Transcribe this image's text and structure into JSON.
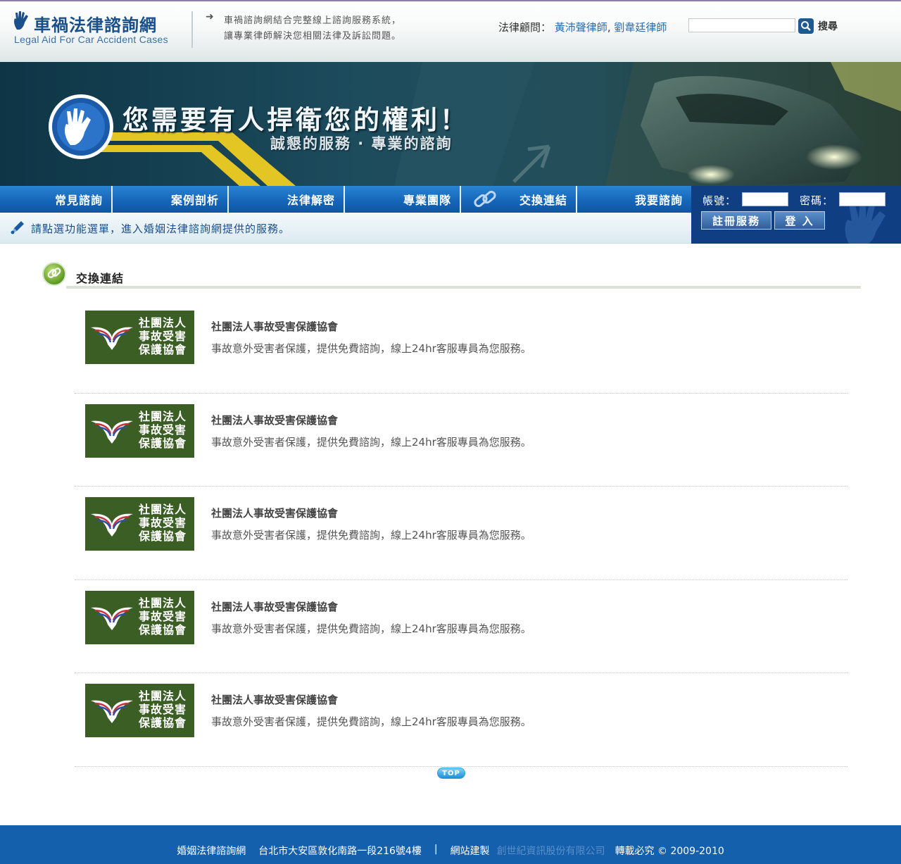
{
  "header": {
    "logo_title": "車禍法律諮詢網",
    "logo_subtitle": "Legal Aid For Car Accident Cases",
    "intro_line1": "車禍諮詢網結合完整線上諮詢服務系統，",
    "intro_line2": "讓專業律師解決您相關法律及訴訟問題。",
    "advisor_label": "法律顧問：",
    "advisor_1": "黃沛聲律師",
    "advisor_sep": ",",
    "advisor_2": "劉韋廷律師",
    "search_button": "搜尋"
  },
  "banner": {
    "headline": "您需要有人捍衛您的權利！",
    "subline": "誠懇的服務 · 專業的諮詢"
  },
  "nav": {
    "items": [
      {
        "label": "常見諮詢"
      },
      {
        "label": "案例剖析"
      },
      {
        "label": "法律解密"
      },
      {
        "label": "專業團隊"
      },
      {
        "label": "交換連結"
      },
      {
        "label": "我要諮詢"
      }
    ]
  },
  "subbar": {
    "message": "請點選功能選單，進入婚姻法律諮詢網提供的服務。"
  },
  "login": {
    "account_label": "帳號：",
    "password_label": "密碼：",
    "register_button": "註冊服務",
    "login_button": "登 入"
  },
  "section": {
    "title": "交換連結"
  },
  "links": [
    {
      "logo_line1": "社團法人",
      "logo_line2": "事故受害",
      "logo_line3": "保護協會",
      "title": "社團法人事故受害保護協會",
      "desc": "事故意外受害者保護，提供免費諮詢，線上24hr客服專員為您服務。"
    },
    {
      "logo_line1": "社團法人",
      "logo_line2": "事故受害",
      "logo_line3": "保護協會",
      "title": "社團法人事故受害保護協會",
      "desc": "事故意外受害者保護，提供免費諮詢，線上24hr客服專員為您服務。"
    },
    {
      "logo_line1": "社團法人",
      "logo_line2": "事故受害",
      "logo_line3": "保護協會",
      "title": "社團法人事故受害保護協會",
      "desc": "事故意外受害者保護，提供免費諮詢，線上24hr客服專員為您服務。"
    },
    {
      "logo_line1": "社團法人",
      "logo_line2": "事故受害",
      "logo_line3": "保護協會",
      "title": "社團法人事故受害保護協會",
      "desc": "事故意外受害者保護，提供免費諮詢，線上24hr客服專員為您服務。"
    },
    {
      "logo_line1": "社團法人",
      "logo_line2": "事故受害",
      "logo_line3": "保護協會",
      "title": "社團法人事故受害保護協會",
      "desc": "事故意外受害者保護，提供免費諮詢，線上24hr客服專員為您服務。"
    }
  ],
  "top_button": "TOP",
  "footer": {
    "site_name": "婚姻法律諮詢網",
    "address": "台北市大安區敦化南路一段216號4樓",
    "separator": "|",
    "built_by_label": "網站建製",
    "company": "創世紀資訊股份有限公司",
    "copyright": "轉載必究 © 2009-2010"
  },
  "colors": {
    "nav_blue": "#1666b9",
    "login_panel": "#103e82",
    "footer_blue": "#1460ad",
    "badge_green": "#3b5e24",
    "accent_link": "#2a6db0"
  }
}
